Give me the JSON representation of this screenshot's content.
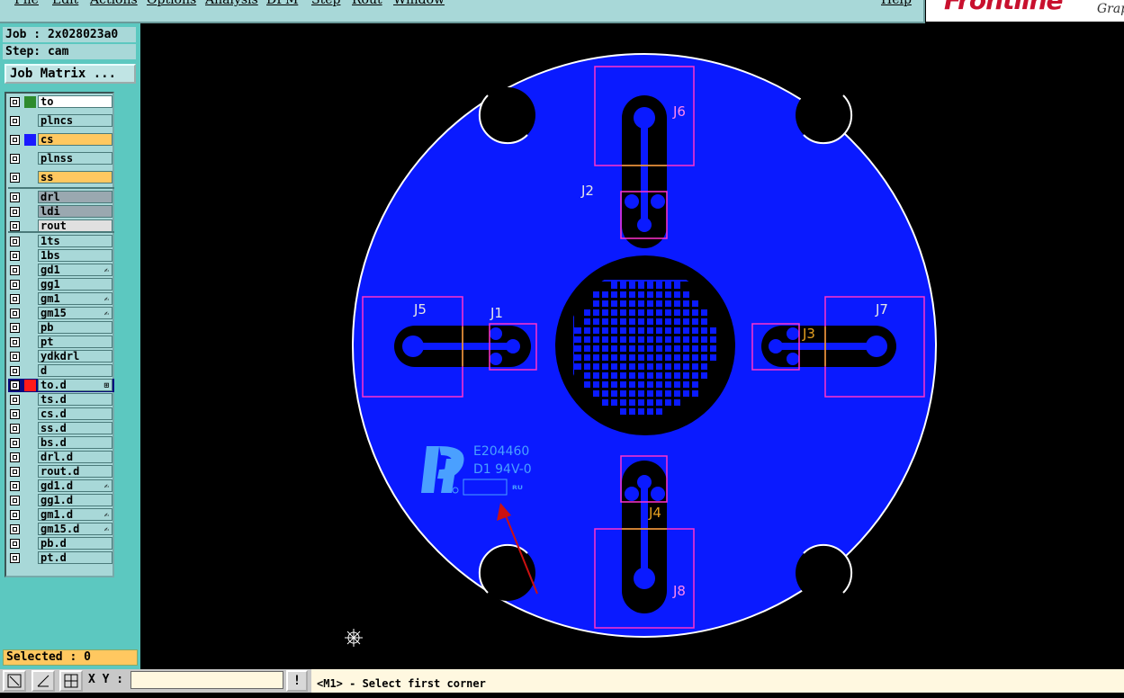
{
  "menubar": {
    "items": [
      "File",
      "Edit",
      "Actions",
      "Options",
      "Analysis",
      "DFM",
      "Step",
      "Rout",
      "Window"
    ],
    "help": "Help"
  },
  "logo": {
    "brand": "Frontline",
    "sub": "Grap"
  },
  "info": {
    "job": "Job : 2x028023a0",
    "step": "Step: cam"
  },
  "job_matrix_button": "Job Matrix ...",
  "layers": [
    {
      "name": "to",
      "swatch": "#2e8b2e",
      "bg": "#ffffff"
    },
    {
      "name": "plncs",
      "swatch": "",
      "bg": "#a8d8d8"
    },
    {
      "name": "cs",
      "swatch": "#1a1aff",
      "bg": "#ffc860"
    },
    {
      "name": "plnss",
      "swatch": "",
      "bg": "#a8d8d8"
    },
    {
      "name": "ss",
      "swatch": "",
      "bg": "#ffc860"
    },
    {
      "name": "drl",
      "swatch": "",
      "bg": "#9aa8b0"
    },
    {
      "name": "ldi",
      "swatch": "",
      "bg": "#9aa8b0"
    },
    {
      "name": "rout",
      "swatch": "",
      "bg": "#e0e0e0"
    },
    {
      "name": "1ts",
      "swatch": "",
      "bg": "#a8d8d8"
    },
    {
      "name": "1bs",
      "swatch": "",
      "bg": "#a8d8d8"
    },
    {
      "name": "gd1",
      "swatch": "",
      "bg": "#a8d8d8",
      "flag": "✍"
    },
    {
      "name": "gg1",
      "swatch": "",
      "bg": "#a8d8d8"
    },
    {
      "name": "gm1",
      "swatch": "",
      "bg": "#a8d8d8",
      "flag": "✍"
    },
    {
      "name": "gm15",
      "swatch": "",
      "bg": "#a8d8d8",
      "flag": "✍"
    },
    {
      "name": "pb",
      "swatch": "",
      "bg": "#a8d8d8"
    },
    {
      "name": "pt",
      "swatch": "",
      "bg": "#a8d8d8"
    },
    {
      "name": "ydkdrl",
      "swatch": "",
      "bg": "#a8d8d8"
    },
    {
      "name": "d",
      "swatch": "",
      "bg": "#a8d8d8"
    },
    {
      "name": "to.d",
      "swatch": "#ff1a1a",
      "bg": "#a8d8d8",
      "flag": "⊞",
      "active": true
    },
    {
      "name": "ts.d",
      "swatch": "",
      "bg": "#a8d8d8"
    },
    {
      "name": "cs.d",
      "swatch": "",
      "bg": "#a8d8d8"
    },
    {
      "name": "ss.d",
      "swatch": "",
      "bg": "#a8d8d8"
    },
    {
      "name": "bs.d",
      "swatch": "",
      "bg": "#a8d8d8"
    },
    {
      "name": "drl.d",
      "swatch": "",
      "bg": "#a8d8d8"
    },
    {
      "name": "rout.d",
      "swatch": "",
      "bg": "#a8d8d8"
    },
    {
      "name": "gd1.d",
      "swatch": "",
      "bg": "#a8d8d8",
      "flag": "✍"
    },
    {
      "name": "gg1.d",
      "swatch": "",
      "bg": "#a8d8d8"
    },
    {
      "name": "gm1.d",
      "swatch": "",
      "bg": "#a8d8d8",
      "flag": "✍"
    },
    {
      "name": "gm15.d",
      "swatch": "",
      "bg": "#a8d8d8",
      "flag": "✍"
    },
    {
      "name": "pb.d",
      "swatch": "",
      "bg": "#a8d8d8"
    },
    {
      "name": "pt.d",
      "swatch": "",
      "bg": "#a8d8d8"
    }
  ],
  "selected": "Selected : 0",
  "bottom": {
    "xy_label": "X Y :",
    "xy_value": "",
    "warn": "!",
    "status": "<M1> - Select first corner"
  },
  "board": {
    "refdes": [
      "J2",
      "J5",
      "J1",
      "J7",
      "J3",
      "J4",
      "J6",
      "J8"
    ],
    "marking_line1": "E204460",
    "marking_line2": "D1  94V-0",
    "colors": {
      "copper": "#0a1aff",
      "outline": "#ffffff",
      "box": "#ff33cc",
      "label": "#e6e6e6",
      "highlight": "#e6a020",
      "logo": "#4aa0ff",
      "arrow": "#cc1111"
    }
  }
}
